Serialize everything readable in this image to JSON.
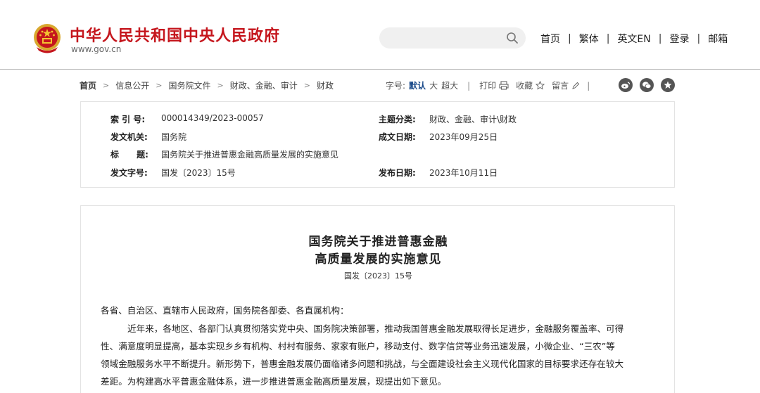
{
  "header": {
    "site_title": "中华人民共和国中央人民政府",
    "site_url": "www.gov.cn",
    "search": {
      "placeholder": ""
    },
    "nav": [
      "首页",
      "繁体",
      "英文EN",
      "登录",
      "邮箱"
    ],
    "nav_separator": "|",
    "brand_color": "#c5161d"
  },
  "breadcrumb": {
    "items": [
      "首页",
      "信息公开",
      "国务院文件",
      "财政、金融、审计",
      "财政"
    ],
    "separator": ">"
  },
  "tools": {
    "font_size_label": "字号:",
    "sizes": [
      "默认",
      "大",
      "超大"
    ],
    "active_size": "默认",
    "print": "打印",
    "favorite": "收藏",
    "comment": "留言",
    "bar": "|"
  },
  "social_icons": [
    "weibo-icon",
    "wechat-icon",
    "app-icon"
  ],
  "info": {
    "index_label": "索  引  号:",
    "index_value": "000014349/2023-00057",
    "topic_label": "主题分类:",
    "topic_value": "财政、金融、审计\\财政",
    "issuer_label": "发文机关:",
    "issuer_value": "国务院",
    "written_label": "成文日期:",
    "written_value": "2023年09月25日",
    "title_label": "标      题:",
    "title_value": "国务院关于推进普惠金融高质量发展的实施意见",
    "doc_no_label": "发文字号:",
    "doc_no_value": "国发〔2023〕15号",
    "published_label": "发布日期:",
    "published_value": "2023年10月11日"
  },
  "document": {
    "title_line1": "国务院关于推进普惠金融",
    "title_line2": "高质量发展的实施意见",
    "doc_number": "国发〔2023〕15号",
    "salutation": "各省、自治区、直辖市人民政府，国务院各部委、各直属机构：",
    "body_lines": [
      "近年来，各地区、各部门认真贯彻落实党中央、国务院决策部署，推动我国普惠金融发展取得长足进步，金融服务覆盖率、可得",
      "性、满意度明显提高，基本实现乡乡有机构、村村有服务、家家有账户，移动支付、数字信贷等业务迅速发展，小微企业、“三农”等",
      "领域金融服务水平不断提升。新形势下，普惠金融发展仍面临诸多问题和挑战，与全面建设社会主义现代化国家的目标要求还存在较大",
      "差距。为构建高水平普惠金融体系，进一步推进普惠金融高质量发展，现提出如下意见。"
    ]
  }
}
